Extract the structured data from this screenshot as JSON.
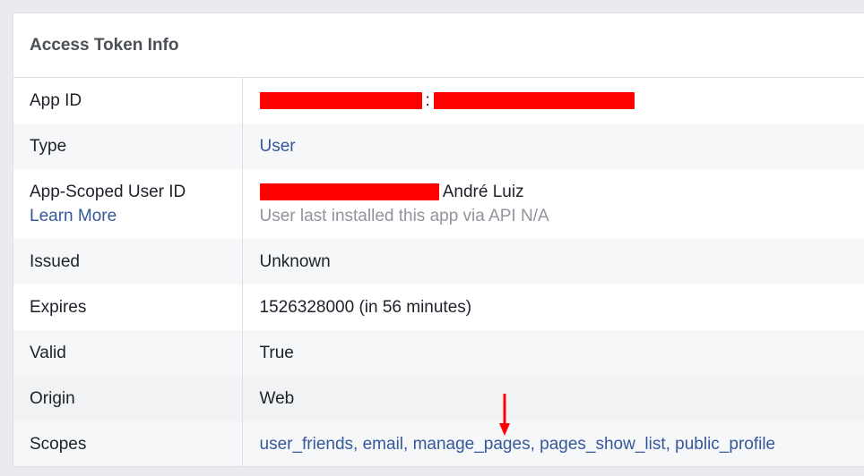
{
  "panel": {
    "title": "Access Token Info"
  },
  "rows": {
    "app_id": {
      "label": "App ID",
      "separator": ":"
    },
    "type": {
      "label": "Type",
      "value": "User"
    },
    "user_id": {
      "label": "App-Scoped User ID",
      "learn_more": "Learn More",
      "name": "André Luiz",
      "install_note": "User last installed this app via API N/A"
    },
    "issued": {
      "label": "Issued",
      "value": "Unknown"
    },
    "expires": {
      "label": "Expires",
      "value": "1526328000 (in 56 minutes)"
    },
    "valid": {
      "label": "Valid",
      "value": "True"
    },
    "origin": {
      "label": "Origin",
      "value": "Web"
    },
    "scopes": {
      "label": "Scopes",
      "value": "user_friends, email, manage_pages, pages_show_list, public_profile"
    }
  },
  "colors": {
    "link": "#365899",
    "redaction": "#ff0000",
    "annotation_arrow": "#ff0000",
    "stripe": "#f6f7f9"
  },
  "icons": {
    "annotation": "red-down-arrow-icon"
  }
}
